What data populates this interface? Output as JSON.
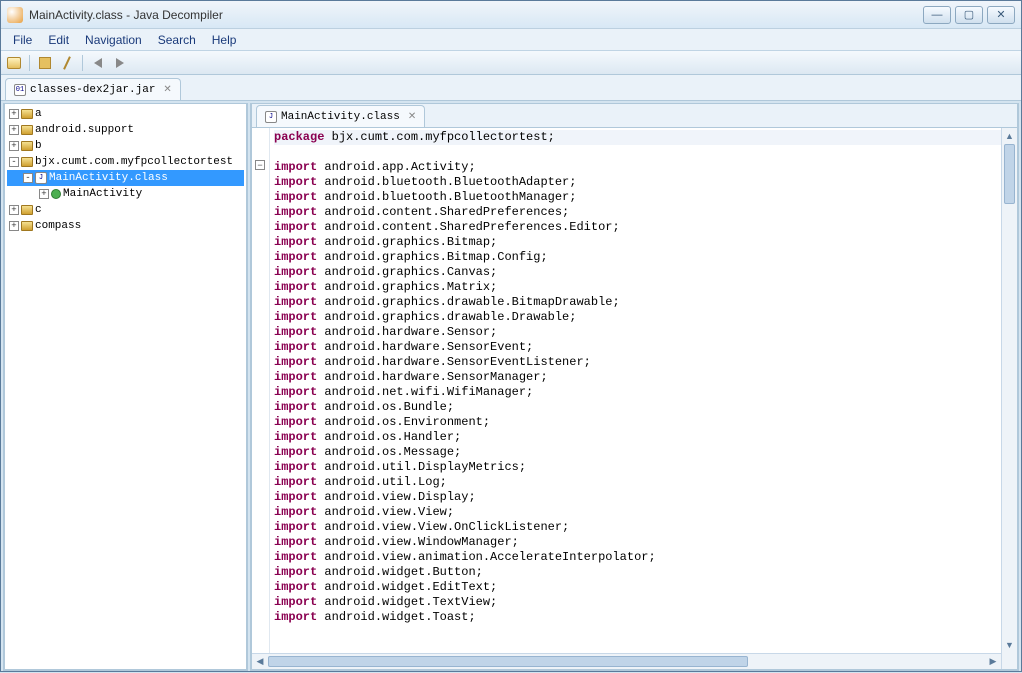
{
  "title": "MainActivity.class - Java Decompiler",
  "menu": [
    "File",
    "Edit",
    "Navigation",
    "Search",
    "Help"
  ],
  "outer_tab": {
    "label": "classes-dex2jar.jar"
  },
  "tree": [
    {
      "type": "pkg",
      "label": "a",
      "exp": "+",
      "indent": 0
    },
    {
      "type": "pkg",
      "label": "android.support",
      "exp": "+",
      "indent": 0
    },
    {
      "type": "pkg",
      "label": "b",
      "exp": "+",
      "indent": 0
    },
    {
      "type": "pkg",
      "label": "bjx.cumt.com.myfpcollectortest",
      "exp": "-",
      "indent": 0
    },
    {
      "type": "cls",
      "label": "MainActivity.class",
      "exp": "-",
      "indent": 1,
      "selected": true
    },
    {
      "type": "grn",
      "label": "MainActivity",
      "exp": "+",
      "indent": 2
    },
    {
      "type": "pkg",
      "label": "c",
      "exp": "+",
      "indent": 0
    },
    {
      "type": "pkg",
      "label": "compass",
      "exp": "+",
      "indent": 0
    }
  ],
  "editor_tab": {
    "label": "MainActivity.class"
  },
  "package_line": "bjx.cumt.com.myfpcollectortest;",
  "imports": [
    "android.app.Activity;",
    "android.bluetooth.BluetoothAdapter;",
    "android.bluetooth.BluetoothManager;",
    "android.content.SharedPreferences;",
    "android.content.SharedPreferences.Editor;",
    "android.graphics.Bitmap;",
    "android.graphics.Bitmap.Config;",
    "android.graphics.Canvas;",
    "android.graphics.Matrix;",
    "android.graphics.drawable.BitmapDrawable;",
    "android.graphics.drawable.Drawable;",
    "android.hardware.Sensor;",
    "android.hardware.SensorEvent;",
    "android.hardware.SensorEventListener;",
    "android.hardware.SensorManager;",
    "android.net.wifi.WifiManager;",
    "android.os.Bundle;",
    "android.os.Environment;",
    "android.os.Handler;",
    "android.os.Message;",
    "android.util.DisplayMetrics;",
    "android.util.Log;",
    "android.view.Display;",
    "android.view.View;",
    "android.view.View.OnClickListener;",
    "android.view.WindowManager;",
    "android.view.animation.AccelerateInterpolator;",
    "android.widget.Button;",
    "android.widget.EditText;",
    "android.widget.TextView;",
    "android.widget.Toast;"
  ],
  "kw_package": "package",
  "kw_import": "import"
}
